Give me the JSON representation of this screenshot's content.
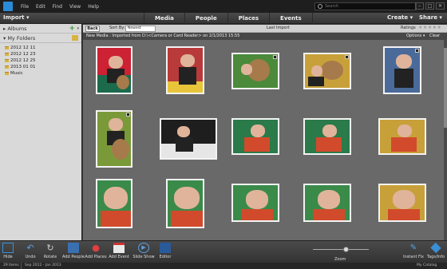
{
  "titlebar": {
    "menu": [
      "File",
      "Edit",
      "Find",
      "View",
      "Help"
    ],
    "search_placeholder": "Search",
    "window_buttons": [
      "–",
      "□",
      "✕"
    ]
  },
  "toolbar": {
    "import_label": "Import ▾",
    "tabs": [
      "Media",
      "People",
      "Places",
      "Events"
    ],
    "create_label": "Create ▾",
    "share_label": "Share ▾"
  },
  "left_panel": {
    "albums_label": "▸ Albums",
    "my_folders_label": "▾ My Folders",
    "folders": [
      "2012 12 11",
      "2012 12 23",
      "2012 12 25",
      "2013 01 01",
      "Music"
    ]
  },
  "sortbar": {
    "back_label": "Back",
    "sort_by_label": "Sort By:",
    "sort_value": "Newest",
    "last_import_label": "Last Import",
    "ratings_label": "Ratings",
    "stars": "★★★★★"
  },
  "infobar": {
    "path": "New Media : Imported from D:\\<Camera or Card Reader> on 2/1/2013 15:55",
    "options_label": "Options ▾",
    "clear_label": "Clear"
  },
  "bottom_toolbar": {
    "buttons": [
      "Hide",
      "Undo",
      "Rotate",
      "Add People",
      "Add Places",
      "Add Event",
      "Slide Show",
      "Editor",
      "Instant Fix",
      "Tags/Info"
    ],
    "zoom_label": "Zoom"
  },
  "status": {
    "count": "29 Items",
    "range": "Sep 2012 - Jan 2013",
    "catalog": "My Catalog"
  },
  "colors": {
    "grid_bg": "#696969",
    "panel_bg": "#d9d9d9",
    "accent": "#2a8bd6"
  }
}
